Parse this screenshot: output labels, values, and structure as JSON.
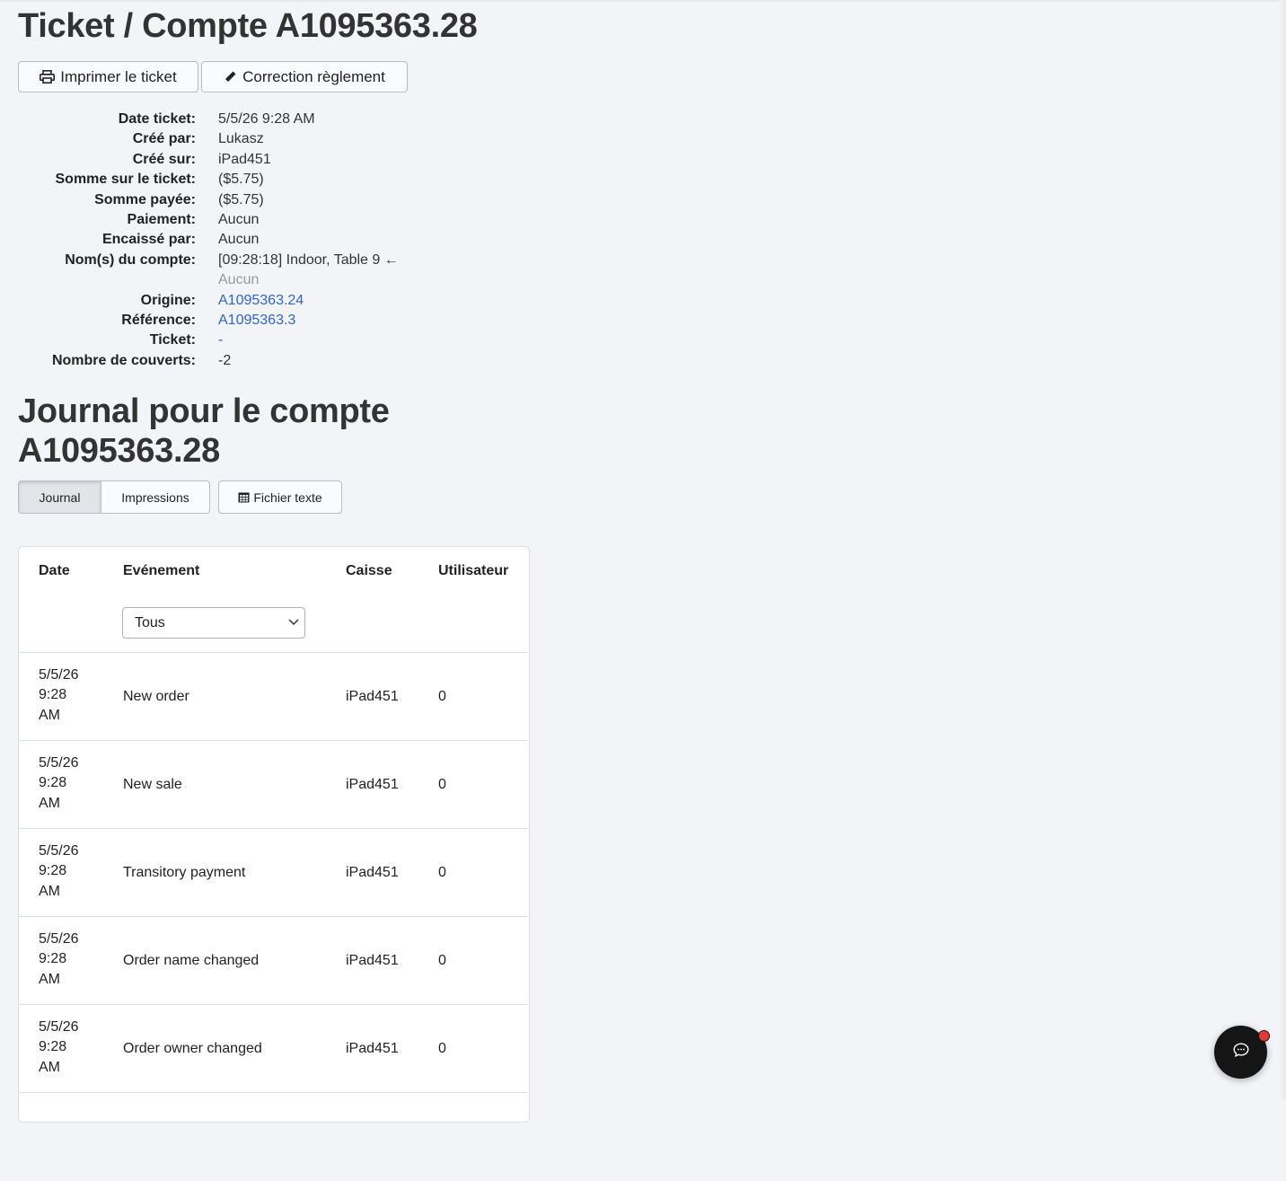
{
  "page": {
    "title": "Ticket / Compte A1095363.28"
  },
  "toolbar": {
    "print_label": "Imprimer le ticket",
    "correction_label": "Correction règlement"
  },
  "details": [
    {
      "label": "Date ticket:",
      "value": "5/5/26 9:28 AM",
      "style": "plain"
    },
    {
      "label": "Créé par:",
      "value": "Lukasz",
      "style": "plain"
    },
    {
      "label": "Créé sur:",
      "value": "iPad451",
      "style": "plain"
    },
    {
      "label": "Somme sur le ticket:",
      "value": "($5.75)",
      "style": "plain"
    },
    {
      "label": "Somme payée:",
      "value": "($5.75)",
      "style": "plain"
    },
    {
      "label": "Paiement:",
      "value": "Aucun",
      "style": "plain"
    },
    {
      "label": "Encaissé par:",
      "value": "Aucun",
      "style": "plain"
    },
    {
      "label": "Nom(s) du compte:",
      "value": "[09:28:18] Indoor, Table 9 ←",
      "style": "plain"
    },
    {
      "label": "",
      "value": "Aucun",
      "style": "muted"
    },
    {
      "label": "Origine:",
      "value": "A1095363.24",
      "style": "link"
    },
    {
      "label": "Référence:",
      "value": "A1095363.3",
      "style": "link"
    },
    {
      "label": "Ticket:",
      "value": "-",
      "style": "link"
    },
    {
      "label": "Nombre de couverts:",
      "value": "-2",
      "style": "plain"
    }
  ],
  "journal": {
    "title_line1": "Journal pour le compte",
    "title_line2": "A1095363.28",
    "tabs": [
      "Journal",
      "Impressions"
    ],
    "active_tab": "Journal",
    "export_label": "Fichier texte",
    "columns": [
      "Date",
      "Evénement",
      "Caisse",
      "Utilisateur"
    ],
    "filter_value": "Tous",
    "rows": [
      {
        "date": [
          "5/5/26",
          "9:28",
          "AM"
        ],
        "event": "New order",
        "register": "iPad451",
        "user": "0"
      },
      {
        "date": [
          "5/5/26",
          "9:28",
          "AM"
        ],
        "event": "New sale",
        "register": "iPad451",
        "user": "0"
      },
      {
        "date": [
          "5/5/26",
          "9:28",
          "AM"
        ],
        "event": "Transitory payment",
        "register": "iPad451",
        "user": "0"
      },
      {
        "date": [
          "5/5/26",
          "9:28",
          "AM"
        ],
        "event": "Order name changed",
        "register": "iPad451",
        "user": "0"
      },
      {
        "date": [
          "5/5/26",
          "9:28",
          "AM"
        ],
        "event": "Order owner changed",
        "register": "iPad451",
        "user": "0"
      }
    ]
  },
  "icons": {
    "print": "printer-icon",
    "edit": "pencil-icon",
    "export": "table-icon",
    "chat": "chat-icon",
    "dropdown": "chevron-down-icon"
  },
  "colors": {
    "link": "#2f63d8",
    "background": "#f3f4f7",
    "notification": "#e53935"
  }
}
